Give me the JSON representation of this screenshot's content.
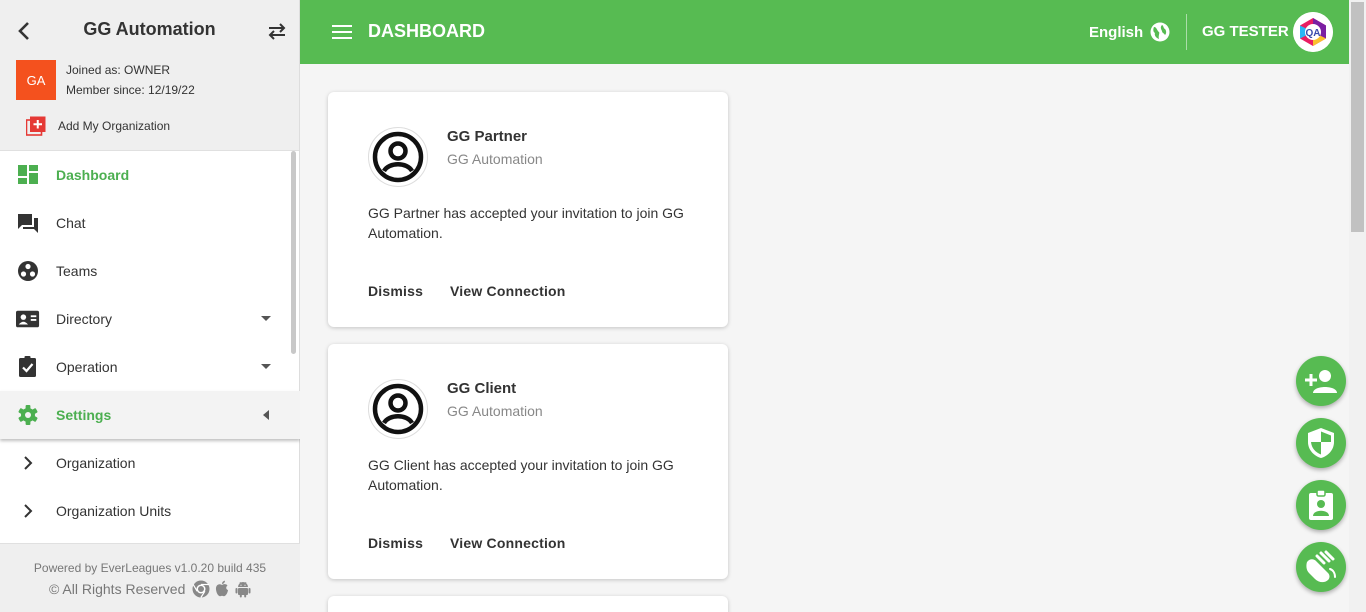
{
  "sidebar": {
    "org_title": "GG Automation",
    "org_initials": "GA",
    "joined_as": "Joined as: OWNER",
    "member_since": "Member since: 12/19/22",
    "add_org_label": "Add My Organization",
    "menu": {
      "dashboard": "Dashboard",
      "chat": "Chat",
      "teams": "Teams",
      "directory": "Directory",
      "operation": "Operation",
      "settings": "Settings",
      "organization": "Organization",
      "organization_units": "Organization Units"
    },
    "footer": {
      "powered_by": "Powered by EverLeagues v1.0.20 build 435",
      "rights": "© All Rights Reserved"
    }
  },
  "header": {
    "title": "DASHBOARD",
    "language": "English",
    "user_name": "GG TESTER",
    "user_avatar_text": "QA"
  },
  "cards": [
    {
      "name": "GG Partner",
      "org": "GG Automation",
      "message": "GG Partner has accepted your invitation to join GG Automation.",
      "dismiss": "Dismiss",
      "view": "View Connection"
    },
    {
      "name": "GG Client",
      "org": "GG Automation",
      "message": "GG Client has accepted your invitation to join GG Automation.",
      "dismiss": "Dismiss",
      "view": "View Connection"
    }
  ],
  "colors": {
    "primary_green": "#57bb52",
    "active_green": "#4caf50",
    "org_avatar": "#f4511e",
    "add_org_icon": "#e53935"
  },
  "fab_icons": [
    "person-add-icon",
    "shield-icon",
    "contact-badge-icon",
    "hand-wave-icon"
  ]
}
